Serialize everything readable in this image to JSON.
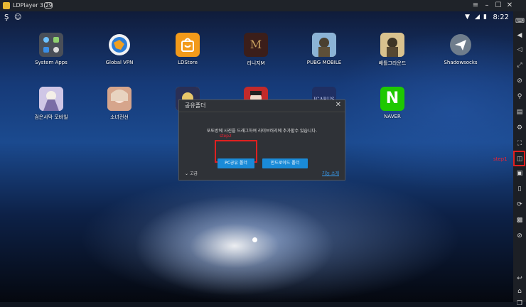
{
  "window": {
    "title": "LDPlayer 3.29"
  },
  "statusbar": {
    "time": "8:22"
  },
  "apps": [
    {
      "name": "System Apps",
      "color": "#4a4f58"
    },
    {
      "name": "Global VPN",
      "color": "#f2f2f2"
    },
    {
      "name": "LDStore",
      "color": "#f29a1a"
    },
    {
      "name": "리니지M",
      "color": "#3b1e1a"
    },
    {
      "name": "PUBG MOBILE",
      "color": "#c8a86a"
    },
    {
      "name": "배틀그라운드",
      "color": "#b99a62"
    },
    {
      "name": "Shadowsocks",
      "color": "#6f7d8c"
    },
    {
      "name": "검은사막 모바일",
      "color": "#d8d0e8"
    },
    {
      "name": "소녀전선",
      "color": "#d9b8a8"
    },
    {
      "name": "",
      "color": "#caa43c"
    },
    {
      "name": "",
      "color": "#b22020"
    },
    {
      "name": "",
      "color": "#1e2a55"
    },
    {
      "name": "NAVER",
      "color": "#1ec800"
    }
  ],
  "naver_logo": "N",
  "dialog": {
    "title": "공유폴더",
    "message": "또또방에 사진을 드래그하여 라이브러리에 추가할수 있습니다.",
    "pc_button": "PC공유 폴더",
    "android_button": "안드로이드 폴더",
    "advanced": "고급",
    "link": "기능 소개",
    "close": "✕",
    "step2": "step2"
  },
  "annotations": {
    "step1": "step1"
  }
}
